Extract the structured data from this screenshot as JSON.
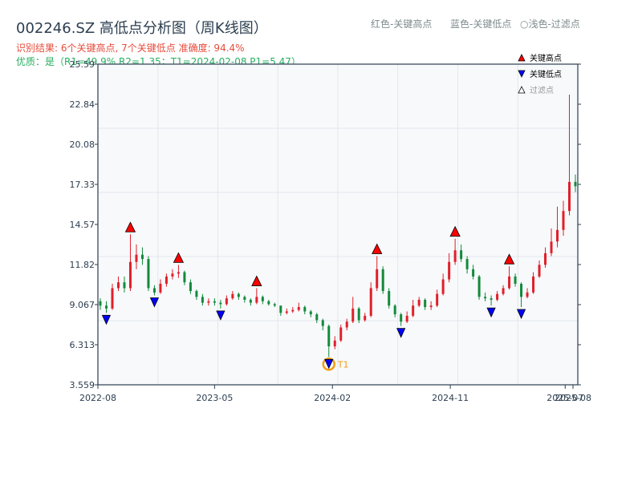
{
  "header": {
    "title": "002246.SZ 高低点分析图（周K线图）",
    "result": "识别结果: 6个关键高点, 7个关键低点   准确度: 94.4%",
    "quality": "优质：是（R1=49.9%  R2=1.35；T1=2024-02-08 P1=5.47）",
    "note_red": "红色-关键高点",
    "note_blue": "蓝色-关键低点",
    "note_light": "○浅色-过滤点"
  },
  "chart_data": {
    "type": "candlestick",
    "ylim": [
      3.559,
      25.59
    ],
    "yticks": [
      "25.59",
      "22.84",
      "20.08",
      "17.33",
      "14.57",
      "11.82",
      "9.067",
      "6.313",
      "3.559"
    ],
    "xticks": [
      {
        "label": "2022-08",
        "at": 0
      },
      {
        "label": "2023-05",
        "at": 19.4
      },
      {
        "label": "2024-02",
        "at": 39
      },
      {
        "label": "2024-11",
        "at": 58.6
      },
      {
        "label": "2025-07",
        "at": 77.7
      },
      {
        "label": "2025-08",
        "at": 79
      }
    ],
    "grid": true,
    "legend_position": "top-right",
    "legend": [
      {
        "label": "关键高点",
        "symbol": "triangle-up",
        "color": "#ff0000"
      },
      {
        "label": "关键低点",
        "symbol": "triangle-down",
        "color": "#0000ff"
      },
      {
        "label": "过滤点",
        "symbol": "triangle-up-hollow",
        "color": "#999999"
      }
    ],
    "colors": {
      "up": "#e0202a",
      "down": "#138a3a",
      "high": "#ff0000",
      "low": "#0000ff",
      "t1": "#f39c12",
      "bg": "#f7f9fb",
      "axis": "#2c3e50"
    },
    "candles_ohlc": [
      [
        9.3,
        9.5,
        8.7,
        9.0
      ],
      [
        9.0,
        9.3,
        8.5,
        8.8
      ],
      [
        8.8,
        10.5,
        8.7,
        10.2
      ],
      [
        10.2,
        11.0,
        10.0,
        10.6
      ],
      [
        10.6,
        11.0,
        9.9,
        10.2
      ],
      [
        10.2,
        13.9,
        10.0,
        12.0
      ],
      [
        12.0,
        13.2,
        11.5,
        12.5
      ],
      [
        12.5,
        13.0,
        11.8,
        12.2
      ],
      [
        12.2,
        12.4,
        10.0,
        10.2
      ],
      [
        10.2,
        10.4,
        9.7,
        9.9
      ],
      [
        9.9,
        10.8,
        9.8,
        10.5
      ],
      [
        10.5,
        11.2,
        10.3,
        11.0
      ],
      [
        11.0,
        11.5,
        10.8,
        11.2
      ],
      [
        11.2,
        11.8,
        10.9,
        11.3
      ],
      [
        11.3,
        11.4,
        10.4,
        10.6
      ],
      [
        10.6,
        10.8,
        9.8,
        10.0
      ],
      [
        10.0,
        10.1,
        9.4,
        9.6
      ],
      [
        9.6,
        9.8,
        9.0,
        9.2
      ],
      [
        9.2,
        9.5,
        9.0,
        9.3
      ],
      [
        9.3,
        9.5,
        9.0,
        9.2
      ],
      [
        9.2,
        9.4,
        8.8,
        9.1
      ],
      [
        9.1,
        9.7,
        9.0,
        9.5
      ],
      [
        9.5,
        10.0,
        9.4,
        9.8
      ],
      [
        9.8,
        9.9,
        9.4,
        9.6
      ],
      [
        9.6,
        9.7,
        9.2,
        9.4
      ],
      [
        9.4,
        9.5,
        9.0,
        9.2
      ],
      [
        9.2,
        10.2,
        9.1,
        9.6
      ],
      [
        9.6,
        9.7,
        9.1,
        9.3
      ],
      [
        9.3,
        9.4,
        9.0,
        9.1
      ],
      [
        9.1,
        9.2,
        8.9,
        9.0
      ],
      [
        9.0,
        9.0,
        8.3,
        8.5
      ],
      [
        8.5,
        8.8,
        8.4,
        8.6
      ],
      [
        8.6,
        8.9,
        8.5,
        8.7
      ],
      [
        8.7,
        9.2,
        8.6,
        8.9
      ],
      [
        8.9,
        9.0,
        8.4,
        8.6
      ],
      [
        8.6,
        8.7,
        8.2,
        8.4
      ],
      [
        8.4,
        8.5,
        7.8,
        8.0
      ],
      [
        8.0,
        8.1,
        7.3,
        7.6
      ],
      [
        7.6,
        7.7,
        5.47,
        6.2
      ],
      [
        6.2,
        6.9,
        6.0,
        6.6
      ],
      [
        6.6,
        7.7,
        6.5,
        7.5
      ],
      [
        7.5,
        8.1,
        7.3,
        7.9
      ],
      [
        7.9,
        9.6,
        7.8,
        8.8
      ],
      [
        8.8,
        8.9,
        7.8,
        8.0
      ],
      [
        8.0,
        8.5,
        7.9,
        8.3
      ],
      [
        8.3,
        10.6,
        8.2,
        10.2
      ],
      [
        10.2,
        12.4,
        10.0,
        11.5
      ],
      [
        11.5,
        11.7,
        9.8,
        10.0
      ],
      [
        10.0,
        10.2,
        8.8,
        9.0
      ],
      [
        9.0,
        9.1,
        8.2,
        8.4
      ],
      [
        8.4,
        8.5,
        7.6,
        7.9
      ],
      [
        7.9,
        8.6,
        7.8,
        8.3
      ],
      [
        8.3,
        9.4,
        8.2,
        9.0
      ],
      [
        9.0,
        9.6,
        8.9,
        9.4
      ],
      [
        9.4,
        9.5,
        8.7,
        8.9
      ],
      [
        8.9,
        9.3,
        8.7,
        9.0
      ],
      [
        9.0,
        10.1,
        8.9,
        9.8
      ],
      [
        9.8,
        11.2,
        9.7,
        10.8
      ],
      [
        10.8,
        12.6,
        10.6,
        12.0
      ],
      [
        12.0,
        13.6,
        11.8,
        12.8
      ],
      [
        12.8,
        13.2,
        12.0,
        12.2
      ],
      [
        12.2,
        12.4,
        11.2,
        11.5
      ],
      [
        11.5,
        11.8,
        10.8,
        11.0
      ],
      [
        11.0,
        11.1,
        9.4,
        9.6
      ],
      [
        9.6,
        9.9,
        9.3,
        9.5
      ],
      [
        9.5,
        9.7,
        9.0,
        9.4
      ],
      [
        9.4,
        10.0,
        9.3,
        9.8
      ],
      [
        9.8,
        10.4,
        9.7,
        10.2
      ],
      [
        10.2,
        11.7,
        10.1,
        11.0
      ],
      [
        11.0,
        11.2,
        10.3,
        10.5
      ],
      [
        10.5,
        10.6,
        8.9,
        9.6
      ],
      [
        9.6,
        10.2,
        9.5,
        9.9
      ],
      [
        9.9,
        11.3,
        9.8,
        11.0
      ],
      [
        11.0,
        12.1,
        10.9,
        11.8
      ],
      [
        11.8,
        13.0,
        11.6,
        12.6
      ],
      [
        12.6,
        14.3,
        12.4,
        13.4
      ],
      [
        13.4,
        15.8,
        13.0,
        14.2
      ],
      [
        14.2,
        16.2,
        13.8,
        15.5
      ],
      [
        15.5,
        23.5,
        15.2,
        17.5
      ],
      [
        17.5,
        18.0,
        16.8,
        17.2
      ]
    ],
    "key_highs": [
      5,
      13,
      26,
      46,
      59,
      68
    ],
    "key_lows": [
      1,
      9,
      20,
      38,
      50,
      65,
      70
    ],
    "t1": {
      "label": "T1",
      "candle": 38
    }
  }
}
